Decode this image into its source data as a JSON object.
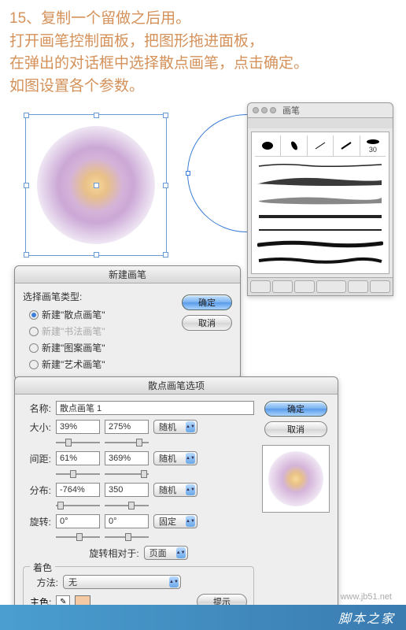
{
  "instructions": {
    "l1": "15、复制一个留做之后用。",
    "l2": "打开画笔控制面板，把图形拖进面板，",
    "l3": "在弹出的对话框中选择散点画笔，点击确定。",
    "l4": "如图设置各个参数。"
  },
  "panel": {
    "title": "画笔",
    "cell_label": "30"
  },
  "dlg1": {
    "title": "新建画笔",
    "select_label": "选择画笔类型:",
    "opt1": "新建\"散点画笔\"",
    "opt2": "新建\"书法画笔\"",
    "opt3": "新建\"图案画笔\"",
    "opt4": "新建\"艺术画笔\"",
    "ok": "确定",
    "cancel": "取消"
  },
  "dlg2": {
    "title": "散点画笔选项",
    "name_lbl": "名称:",
    "name_val": "散点画笔 1",
    "size_lbl": "大小:",
    "size_a": "39%",
    "size_b": "275%",
    "size_mode": "随机",
    "spacing_lbl": "间距:",
    "spacing_a": "61%",
    "spacing_b": "369%",
    "spacing_mode": "随机",
    "scatter_lbl": "分布:",
    "scatter_a": "-764%",
    "scatter_b": "350",
    "scatter_mode": "随机",
    "rotate_lbl": "旋转:",
    "rotate_a": "0°",
    "rotate_b": "0°",
    "rotate_mode": "固定",
    "rel_lbl": "旋转相对于:",
    "rel_val": "页面",
    "tint_legend": "着色",
    "method_lbl": "方法:",
    "method_val": "无",
    "key_lbl": "主色:",
    "hint": "提示",
    "ok": "确定",
    "cancel": "取消"
  },
  "watermark": "www.jb51.net",
  "footer": "脚本之家"
}
